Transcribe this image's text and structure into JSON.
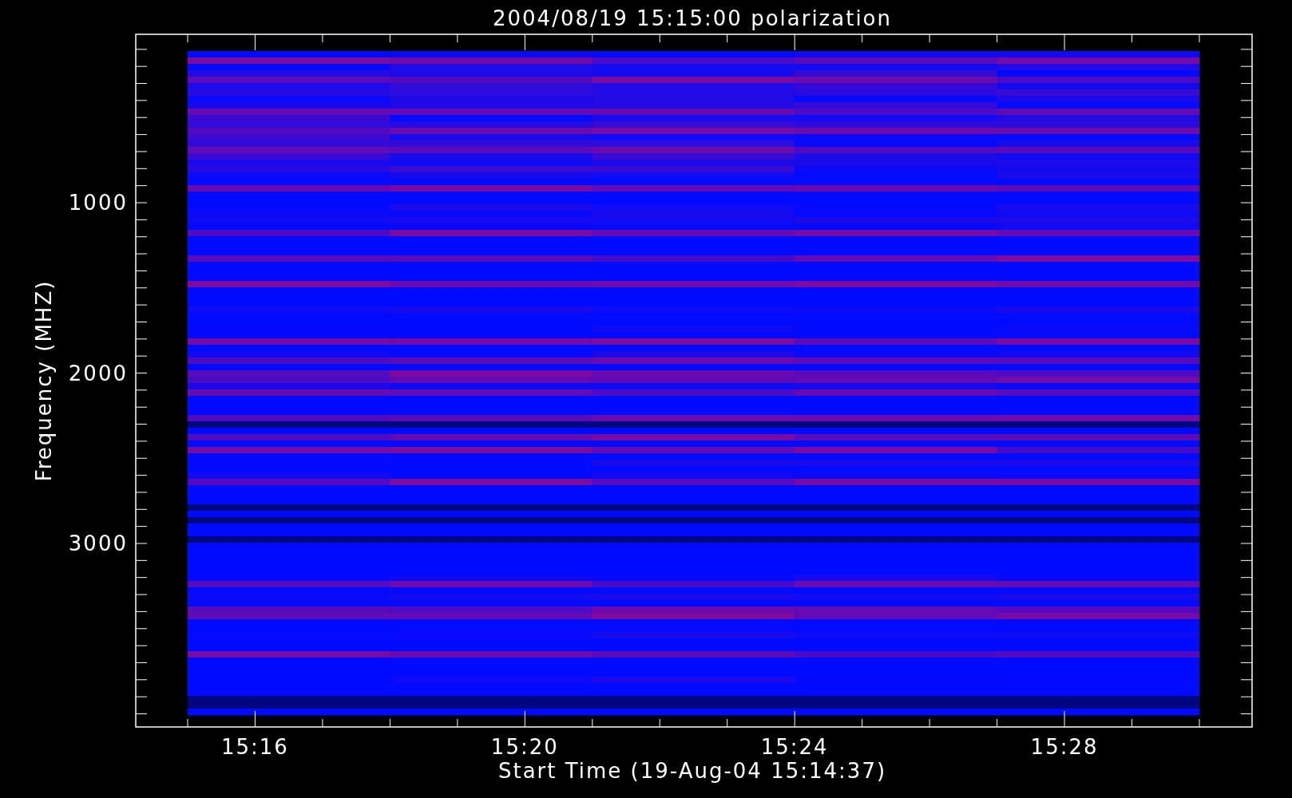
{
  "plot": {
    "title": "2004/08/19 15:15:00 polarization",
    "x_axis": {
      "label": "Start Time (19-Aug-04 15:14:37)",
      "ticks": [
        "15:16",
        "15:20",
        "15:24",
        "15:28"
      ]
    },
    "y_axis": {
      "label": "Frequency (MHZ)",
      "ticks": [
        "1000",
        "2000",
        "3000"
      ]
    }
  }
}
